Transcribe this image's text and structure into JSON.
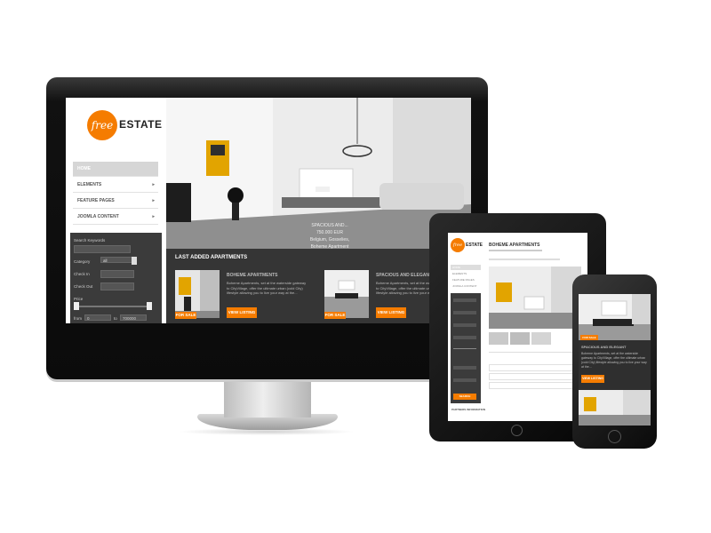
{
  "brand": {
    "logo_script": "free",
    "logo_word": "ESTATE",
    "accent": "#f57c00"
  },
  "desktop": {
    "nav": [
      {
        "label": "HOME",
        "arrow": ""
      },
      {
        "label": "ELEMENTS",
        "arrow": "▸"
      },
      {
        "label": "FEATURE PAGES",
        "arrow": "▸"
      },
      {
        "label": "JOOMLA CONTENT",
        "arrow": "▸"
      }
    ],
    "search": {
      "keywords_label": "Search Keywords",
      "category_label": "Category",
      "category_value": "all",
      "checkin_label": "Check In",
      "checkout_label": "Check Out",
      "price_label": "Price",
      "from_label": "from",
      "from_value": "0",
      "to_label": "to",
      "to_value": "700000"
    },
    "hero_caption": [
      "SPACIOUS AND...",
      "750.000 EUR",
      "Belgium, Gosselies,",
      "Boheme Apartment"
    ],
    "section_title": "LAST ADDED APARTMENTS",
    "listings": [
      {
        "title": "BOHEME APARTMENTS",
        "desc": "Boheme Apartments, set at the waterside gateway to CityVillage, offer the ultimate urban (cold City) lifestyle allowing you to live your way at the...",
        "badge": "FOR SALE",
        "button": "VIEW LISTING"
      },
      {
        "title": "SPACIOUS AND ELEGANT",
        "desc": "Boheme Apartments, set at the waterside gateway to CityVillage, offer the ultimate urban (cold City) lifestyle allowing you to live your way at the...",
        "badge": "FOR SALE",
        "button": "VIEW LISTING"
      }
    ]
  },
  "tablet": {
    "title": "BOHEME APARTMENTS",
    "nav": [
      "HOME",
      "ELEMENTS",
      "FEATURE PAGES",
      "JOOMLA CONTENT"
    ],
    "search_button": "SEARCH",
    "footer_title": "PARTNERS INFORMATION"
  },
  "phone": {
    "listing_title": "SPACIOUS AND ELEGANT",
    "listing_desc": "Boheme Apartments, set at the waterside gateway to CityVillage, offer the ultimate urban (cold City) lifestyle allowing you to live your way at the...",
    "badge": "FOR SALE",
    "button": "VIEW LISTING"
  }
}
